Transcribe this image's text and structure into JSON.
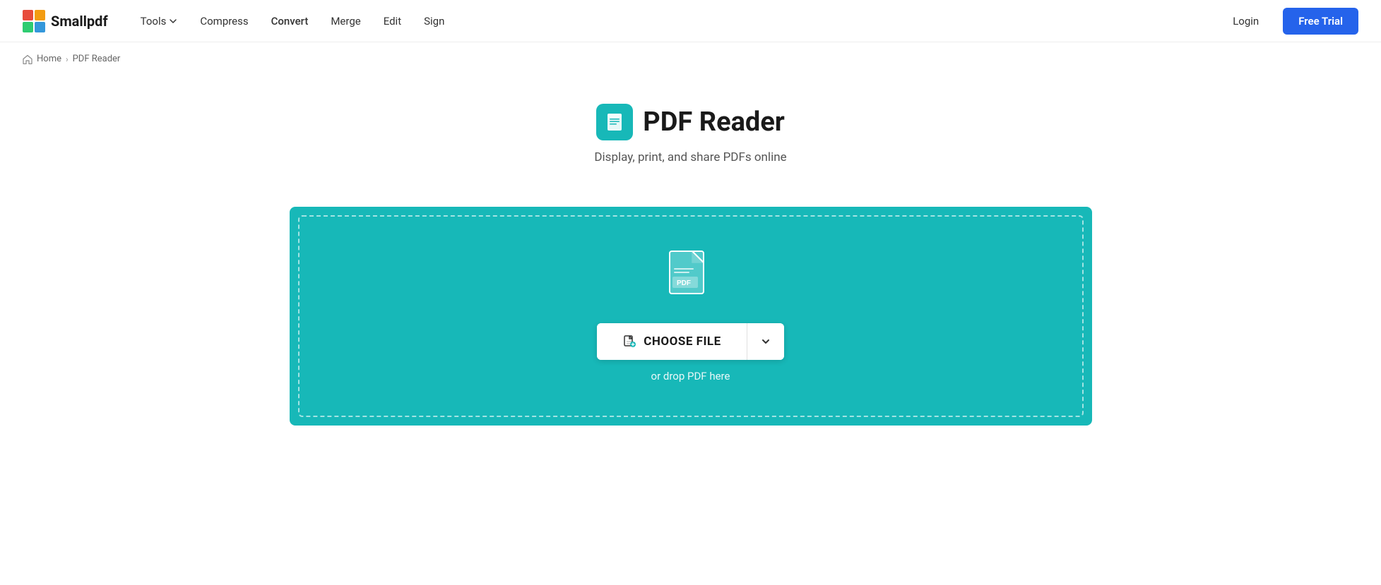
{
  "brand": {
    "name": "Smallpdf",
    "logo_alt": "Smallpdf logo"
  },
  "navbar": {
    "tools_label": "Tools",
    "compress_label": "Compress",
    "convert_label": "Convert",
    "merge_label": "Merge",
    "edit_label": "Edit",
    "sign_label": "Sign",
    "login_label": "Login",
    "free_trial_label": "Free Trial"
  },
  "breadcrumb": {
    "home_label": "Home",
    "current_label": "PDF Reader"
  },
  "hero": {
    "title": "PDF Reader",
    "subtitle": "Display, print, and share PDFs online"
  },
  "upload": {
    "choose_file_label": "CHOOSE FILE",
    "drop_hint": "or drop PDF here"
  }
}
